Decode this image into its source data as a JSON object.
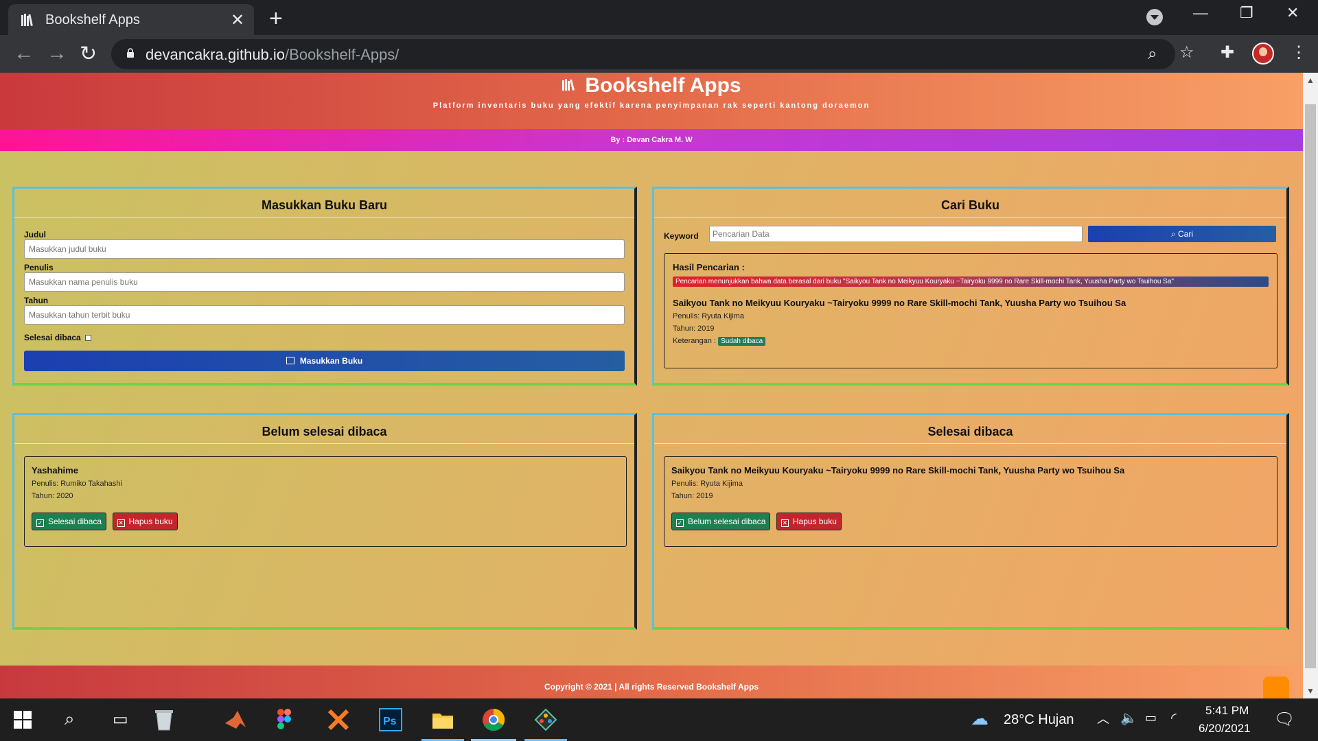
{
  "browser": {
    "tab_title": "Bookshelf Apps",
    "url_host": "devancakra.github.io",
    "url_path": "/Bookshelf-Apps/"
  },
  "app": {
    "title": "Bookshelf Apps",
    "tagline": "Platform inventaris buku yang efektif karena penyimpanan rak seperti kantong doraemon",
    "byline": "By : Devan Cakra M. W",
    "footer": "Copyright © 2021 | All rights Reserved Bookshelf Apps"
  },
  "form": {
    "heading": "Masukkan Buku Baru",
    "judul_label": "Judul",
    "judul_placeholder": "Masukkan judul buku",
    "penulis_label": "Penulis",
    "penulis_placeholder": "Masukkan nama penulis buku",
    "tahun_label": "Tahun",
    "tahun_placeholder": "Masukkan tahun terbit buku",
    "selesai_label": "Selesai dibaca",
    "submit_label": "Masukkan Buku"
  },
  "search": {
    "heading": "Cari Buku",
    "keyword_label": "Keyword",
    "placeholder": "Pencarian Data",
    "button_label": "Cari",
    "result_heading": "Hasil Pencarian :",
    "result_notice": "Pencarian menunjukkan bahwa data berasal dari buku \"Saikyou Tank no Meikyuu Kouryaku ~Tairyoku 9999 no Rare Skill-mochi Tank, Yuusha Party wo Tsuihou Sa\"",
    "result_title": "Saikyou Tank no Meikyuu Kouryaku ~Tairyoku 9999 no Rare Skill-mochi Tank, Yuusha Party wo Tsuihou Sa",
    "result_author": "Penulis: Ryuta Kijima",
    "result_year": "Tahun: 2019",
    "result_status_label": "Keterangan :",
    "result_status": "Sudah dibaca"
  },
  "unread": {
    "heading": "Belum selesai dibaca",
    "book_title": "Yashahime",
    "book_author": "Penulis: Rumiko Takahashi",
    "book_year": "Tahun: 2020",
    "toggle_label": "Selesai dibaca",
    "delete_label": "Hapus buku"
  },
  "read": {
    "heading": "Selesai dibaca",
    "book_title": "Saikyou Tank no Meikyuu Kouryaku ~Tairyoku 9999 no Rare Skill-mochi Tank, Yuusha Party wo Tsuihou Sa",
    "book_author": "Penulis: Ryuta Kijima",
    "book_year": "Tahun: 2019",
    "toggle_label": "Belum selesai dibaca",
    "delete_label": "Hapus buku"
  },
  "taskbar": {
    "weather": "28°C  Hujan",
    "time": "5:41 PM",
    "date": "6/20/2021"
  }
}
